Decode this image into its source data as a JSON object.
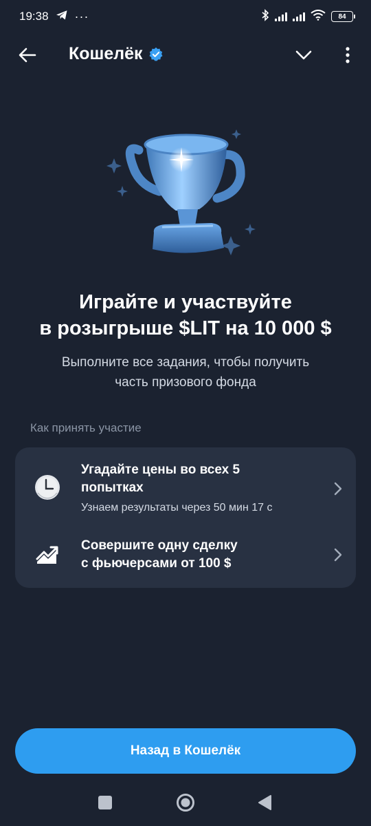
{
  "status_bar": {
    "time": "19:38",
    "dots": "···",
    "battery": "84"
  },
  "header": {
    "title": "Кошелёк",
    "icons": {
      "back": "arrow-left-icon",
      "verified": "verified-badge-icon",
      "expand": "chevron-down-icon",
      "more": "more-vertical-icon"
    }
  },
  "hero": {
    "image": "trophy-icon",
    "headline_line1": "Играйте и участвуйте",
    "headline_line2": "в розыгрыше $LIT на 10 000 $",
    "subtext_line1": "Выполните все задания, чтобы получить",
    "subtext_line2": "часть призового фонда"
  },
  "section": {
    "label": "Как принять участие"
  },
  "tasks": [
    {
      "icon": "clock-icon",
      "title_line1": "Угадайте цены во всех 5",
      "title_line2": "попытках",
      "subtitle": "Узнаем результаты через 50 мин 17 с"
    },
    {
      "icon": "trending-up-icon",
      "title_line1": "Совершите одну сделку",
      "title_line2": "с фьючерсами от 100 $"
    }
  ],
  "footer": {
    "button_label": "Назад в Кошелёк"
  },
  "colors": {
    "background": "#1b2230",
    "card": "#283142",
    "accent": "#2e9df0",
    "muted_text": "#8b95a5"
  }
}
